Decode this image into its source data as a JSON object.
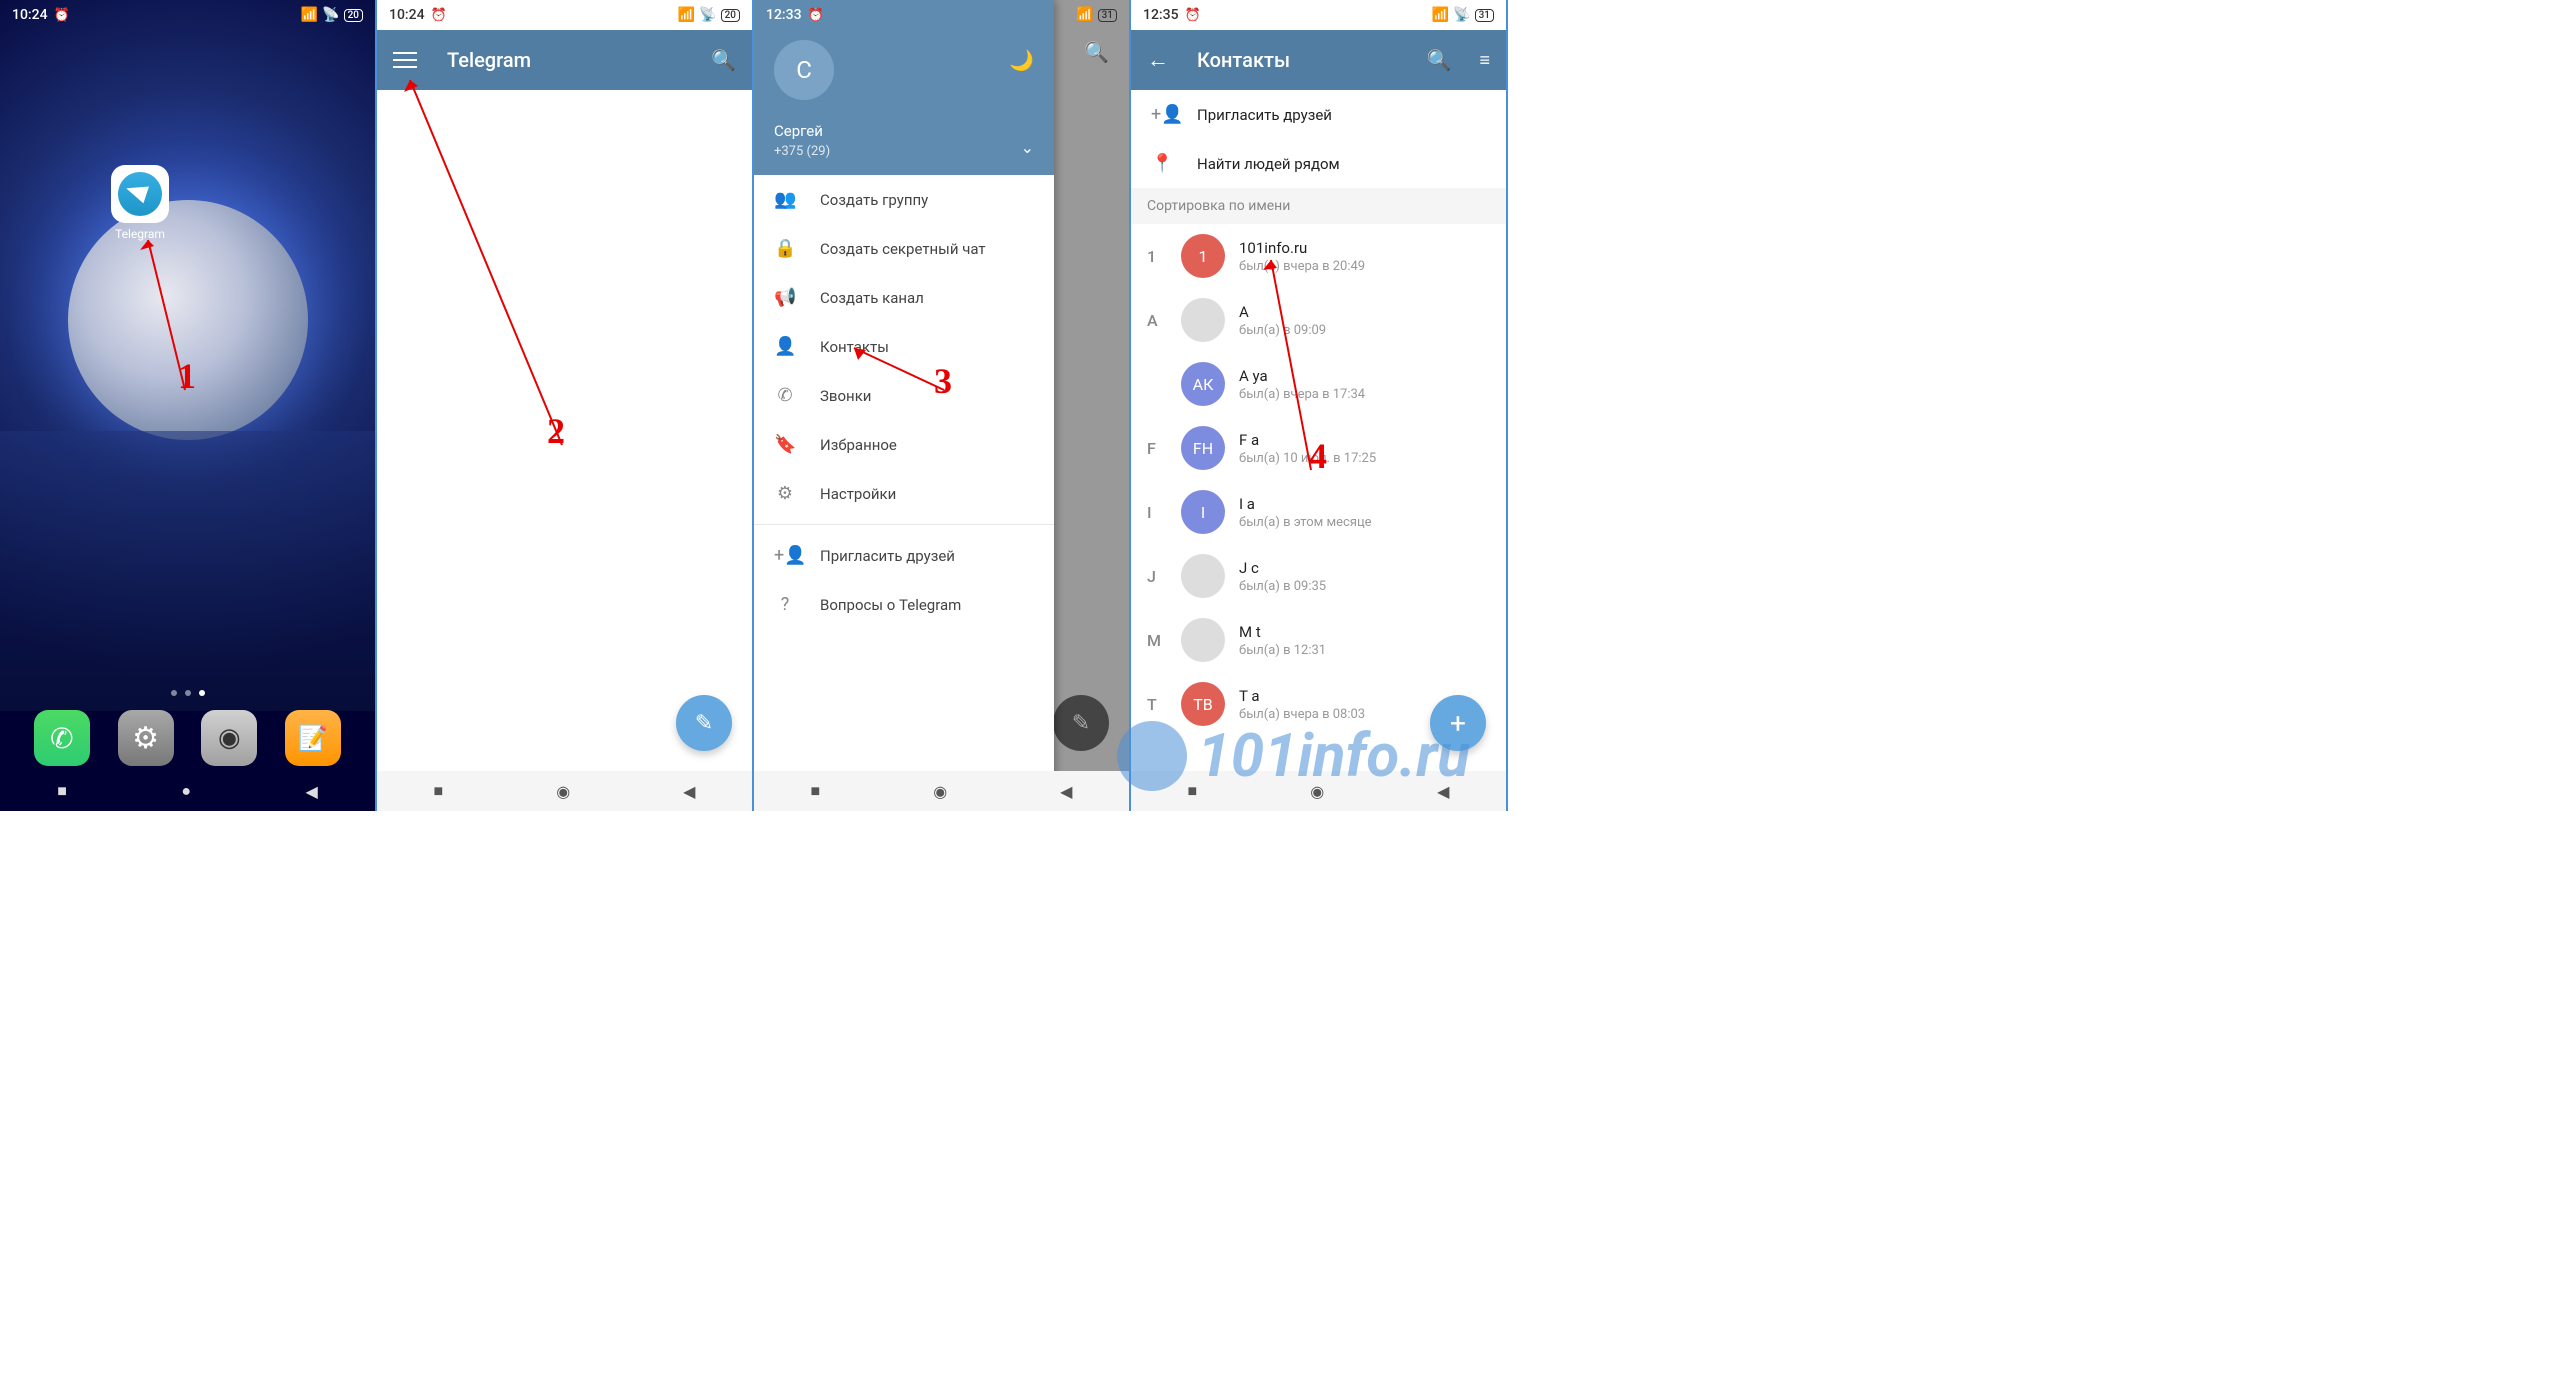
{
  "screen1": {
    "time": "10:24",
    "battery": "20",
    "app_label": "Telegram"
  },
  "screen2": {
    "time": "10:24",
    "battery": "20",
    "title": "Telegram"
  },
  "screen3": {
    "time": "12:33",
    "battery": "31",
    "drawer": {
      "avatar_initial": "С",
      "name": "Сергей",
      "phone": "+375 (29)",
      "items": [
        {
          "icon": "group",
          "label": "Создать группу"
        },
        {
          "icon": "lock",
          "label": "Создать секретный чат"
        },
        {
          "icon": "megaphone",
          "label": "Создать канал"
        },
        {
          "icon": "person",
          "label": "Контакты"
        },
        {
          "icon": "phone",
          "label": "Звонки"
        },
        {
          "icon": "bookmark",
          "label": "Избранное"
        },
        {
          "icon": "gear",
          "label": "Настройки"
        },
        {
          "icon": "invite",
          "label": "Пригласить друзей"
        },
        {
          "icon": "help",
          "label": "Вопросы о Telegram"
        }
      ]
    }
  },
  "screen4": {
    "time": "12:35",
    "battery": "31",
    "title": "Контакты",
    "actions": [
      {
        "icon": "invite",
        "label": "Пригласить друзей"
      },
      {
        "icon": "location",
        "label": "Найти людей рядом"
      }
    ],
    "sort_header": "Сортировка по имени",
    "contacts": [
      {
        "letter": "1",
        "initial": "1",
        "color": "#e06055",
        "name": "101info.ru",
        "status": "был(а) вчера в 20:49"
      },
      {
        "letter": "А",
        "initial": "",
        "color": "#ddd",
        "name": "А",
        "status": "был(а) в 09:09"
      },
      {
        "letter": "",
        "initial": "АК",
        "color": "#7e8ce0",
        "name": "А            ya",
        "status": "был(а) вчера в 17:34"
      },
      {
        "letter": "F",
        "initial": "FH",
        "color": "#7e8ce0",
        "name": "F                  a",
        "status": "был(а) 10 июл. в 17:25"
      },
      {
        "letter": "I",
        "initial": "I",
        "color": "#7e8ce0",
        "name": "I   a",
        "status": "был(а) в этом месяце"
      },
      {
        "letter": "J",
        "initial": "",
        "color": "#ddd",
        "name": "J               c",
        "status": "был(а) в 09:35"
      },
      {
        "letter": "M",
        "initial": "",
        "color": "#ddd",
        "name": "M                      t",
        "status": "был(а) в 12:31"
      },
      {
        "letter": "T",
        "initial": "ТВ",
        "color": "#e06055",
        "name": "T                  a",
        "status": "был(а) вчера в 08:03"
      }
    ]
  },
  "annotations": {
    "n1": "1",
    "n2": "2",
    "n3": "3",
    "n4": "4"
  },
  "watermark": "101info.ru"
}
